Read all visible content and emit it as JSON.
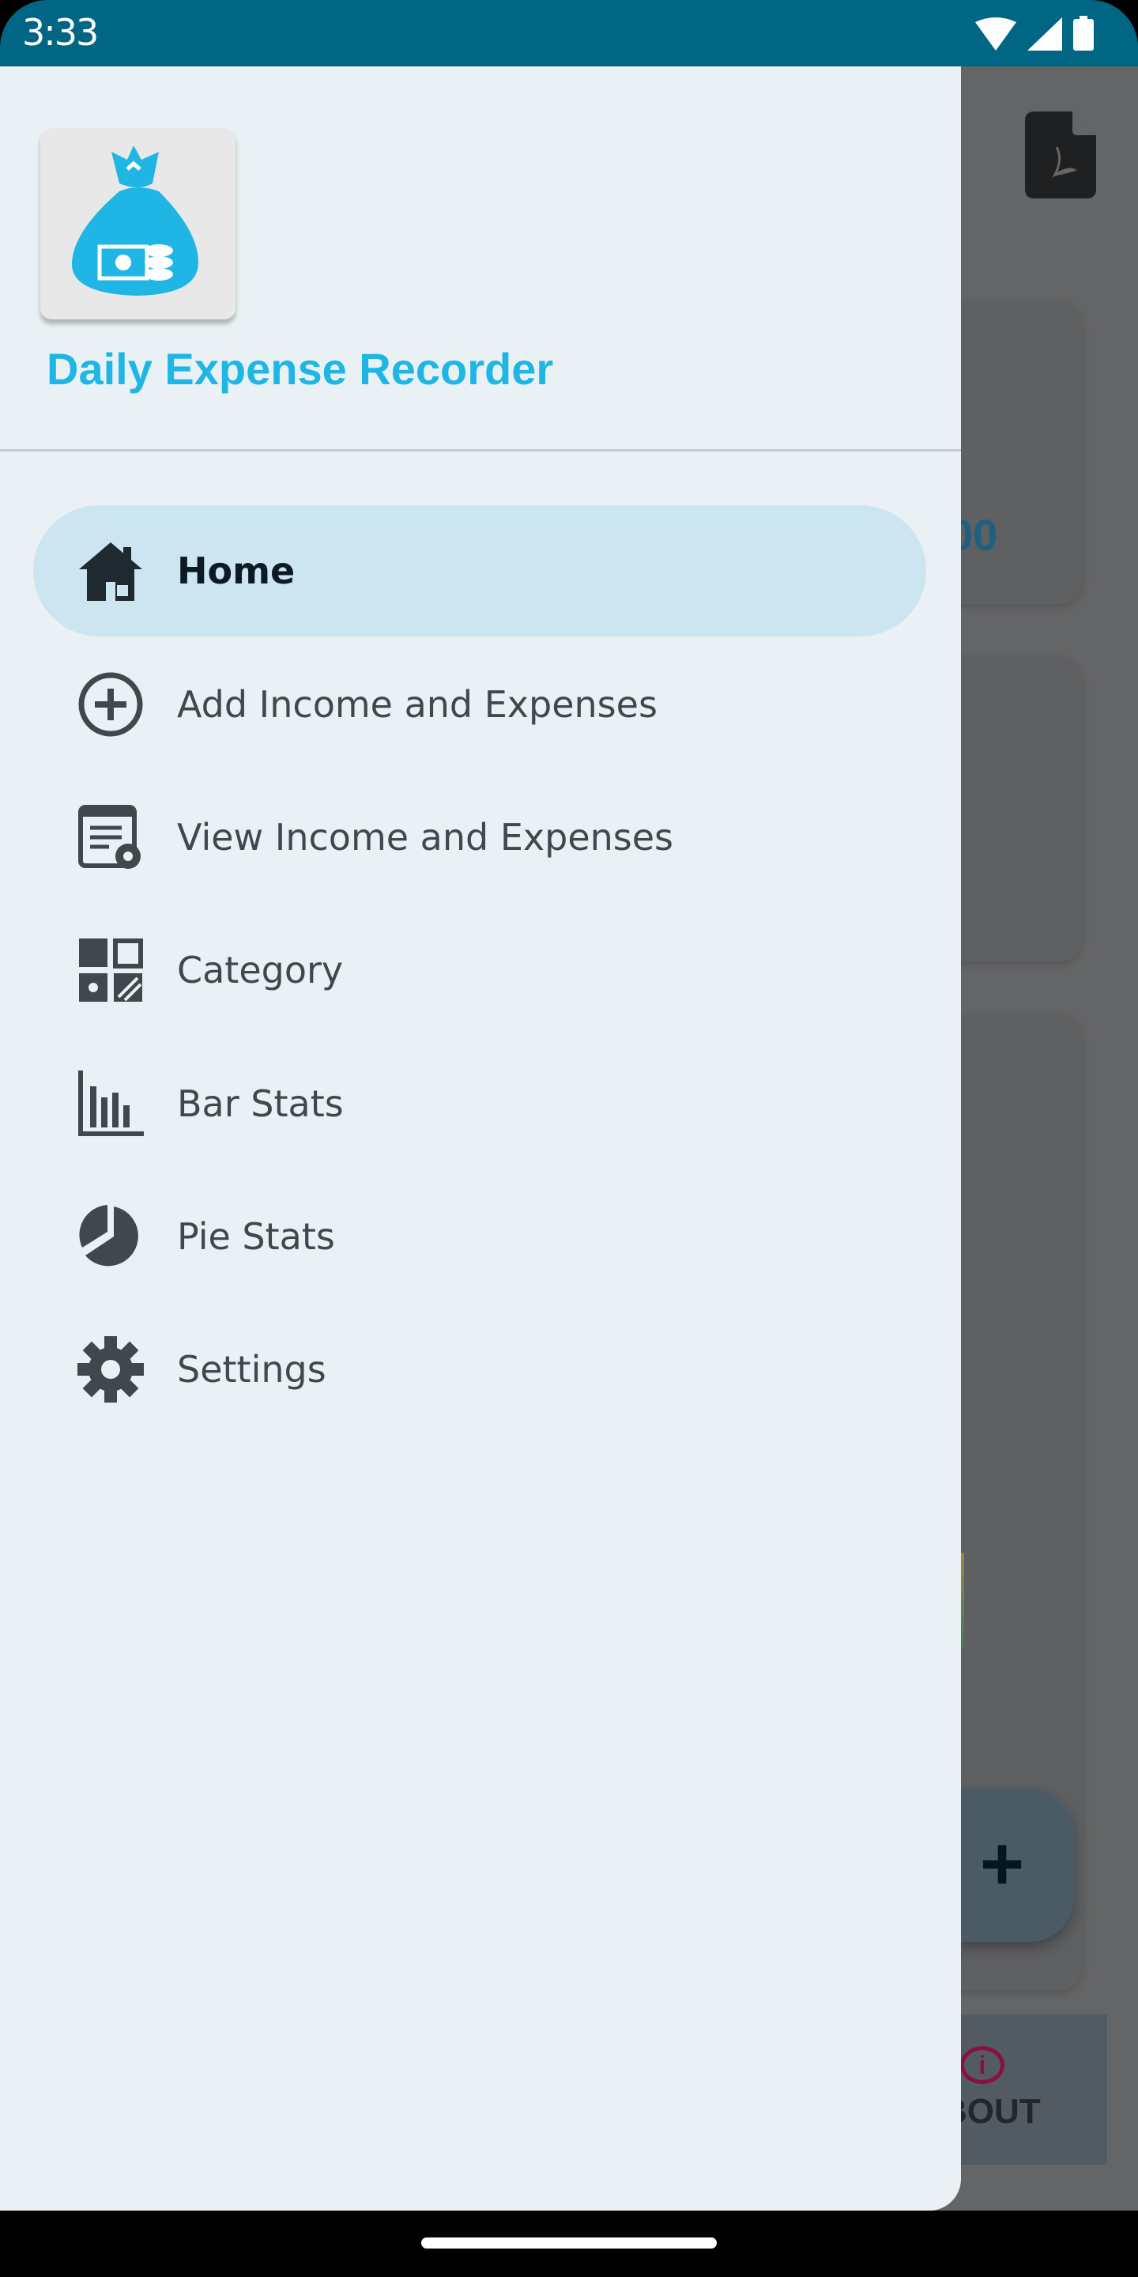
{
  "status_bar": {
    "time": "3:33",
    "icons": [
      "wifi-icon",
      "signal-icon",
      "battery-icon"
    ]
  },
  "background": {
    "amount_fragment": "00",
    "fab_label": "+",
    "bottom_tab_label": "BOUT"
  },
  "drawer": {
    "app_title": "Daily Expense Recorder",
    "items": [
      {
        "label": "Home",
        "icon": "home-icon",
        "active": true
      },
      {
        "label": "Add Income and Expenses",
        "icon": "add-circle-icon"
      },
      {
        "label": "View Income and Expenses",
        "icon": "view-list-icon"
      },
      {
        "label": "Category",
        "icon": "category-icon"
      },
      {
        "label": "Bar Stats",
        "icon": "bar-chart-icon"
      },
      {
        "label": "Pie Stats",
        "icon": "pie-chart-icon"
      },
      {
        "label": "Settings",
        "icon": "gear-icon"
      }
    ]
  },
  "colors": {
    "status_bar": "#006684",
    "accent": "#1fb6e6",
    "active_item": "#cde5f0",
    "drawer_bg": "#eaf1f4"
  }
}
